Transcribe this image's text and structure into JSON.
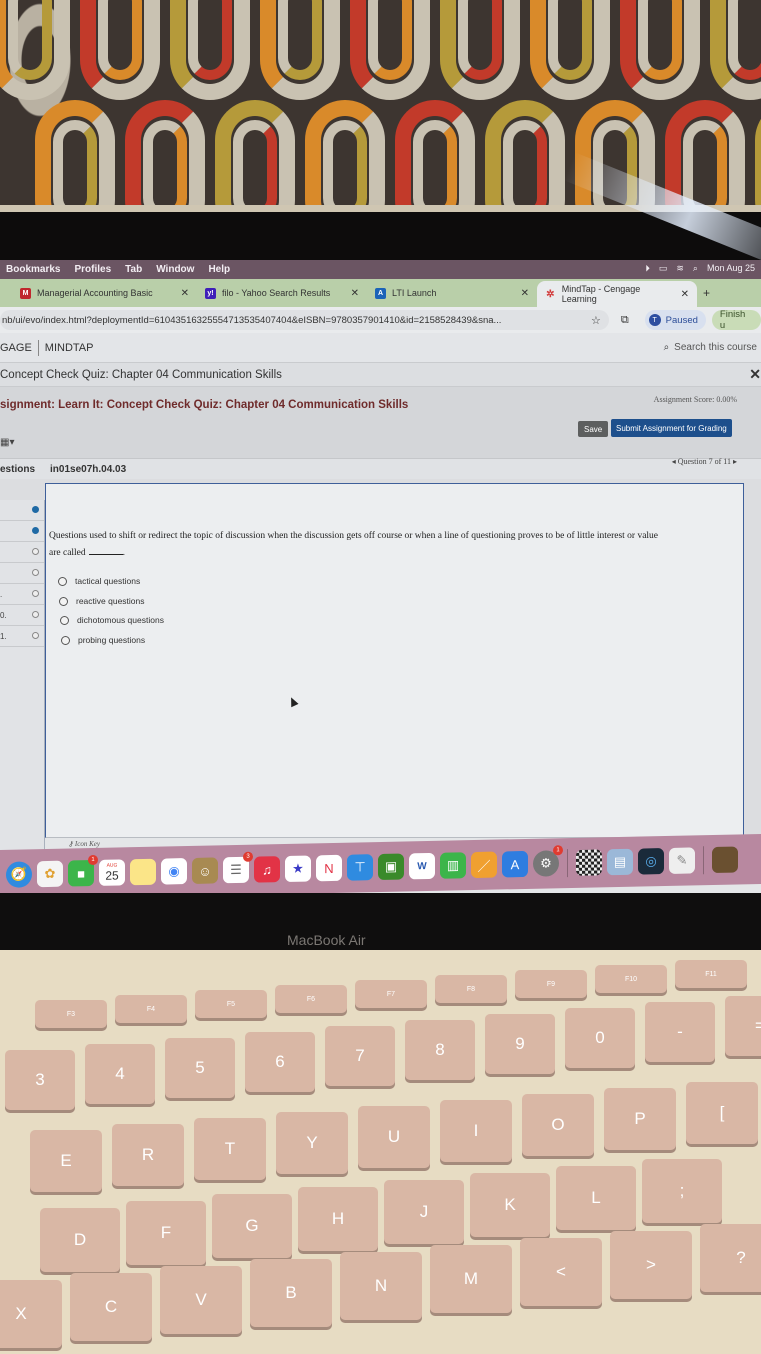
{
  "menubar": {
    "items": [
      "Bookmarks",
      "Profiles",
      "Tab",
      "Window",
      "Help"
    ],
    "clock": "Mon Aug 25"
  },
  "tabs": [
    {
      "label": "Managerial Accounting Basic",
      "favicon": "mcgraw-hill-icon",
      "active": false
    },
    {
      "label": "filo - Yahoo Search Results",
      "favicon": "yahoo-icon",
      "active": false
    },
    {
      "label": "LTI Launch",
      "favicon": "lti-icon",
      "active": false
    },
    {
      "label": "MindTap - Cengage Learning",
      "favicon": "mindtap-icon",
      "active": true
    }
  ],
  "address": {
    "url": "nb/ui/evo/index.html?deploymentId=61043516325554713535407404&eISBN=9780357901410&id=2158528439&sna...",
    "profile_initial": "T",
    "profile_status": "Paused",
    "finish_label": "Finish u"
  },
  "brand": {
    "left": "GAGE",
    "right": "MINDTAP",
    "search_placeholder": "Search this course"
  },
  "breadcrumb": "Concept Check Quiz: Chapter 04 Communication Skills",
  "assignment": {
    "title": "signment: Learn It: Concept Check Quiz: Chapter 04 Communication Skills",
    "score": "Assignment Score: 0.00%",
    "save_label": "Save",
    "submit_label": "Submit Assignment for Grading"
  },
  "question_header": {
    "sidebar_label": "estions",
    "question_id": "in01se07h.04.03",
    "nav": "◂ Question 7 of 11 ▸"
  },
  "sidebar_rows": [
    {
      "num": "",
      "state": "done"
    },
    {
      "num": "",
      "state": "done"
    },
    {
      "num": "",
      "state": "open"
    },
    {
      "num": "",
      "state": "open"
    },
    {
      "num": ".",
      "state": "open"
    },
    {
      "num": "0.",
      "state": "open"
    },
    {
      "num": "1.",
      "state": "open"
    }
  ],
  "question": {
    "prompt_line1": "Questions used to shift or redirect the topic of discussion when the discussion gets off course or when a line of questioning proves to be of little interest or value",
    "prompt_line2": "are called",
    "prompt_end": ".",
    "options": [
      "tactical questions",
      "reactive questions",
      "dichotomous questions",
      "probing questions"
    ]
  },
  "icon_key_label": "Icon Key",
  "dock": {
    "calendar_month": "AUG",
    "calendar_day": "25",
    "facetime_badge": "1",
    "reminders_badge": "3",
    "settings_badge": "1"
  },
  "laptop_label": "MacBook Air",
  "keyboard": {
    "fn_row": [
      "F3",
      "F4",
      "F5",
      "F6",
      "F7",
      "F8",
      "F9",
      "F10",
      "F11"
    ],
    "num_row": [
      "3",
      "4",
      "5",
      "6",
      "7",
      "8",
      "9",
      "0",
      "-",
      "="
    ],
    "top_row": [
      "E",
      "R",
      "T",
      "Y",
      "U",
      "I",
      "O",
      "P",
      "["
    ],
    "home_row": [
      "D",
      "F",
      "G",
      "H",
      "J",
      "K",
      "L",
      ";"
    ],
    "bottom_row": [
      "X",
      "C",
      "V",
      "B",
      "N",
      "M",
      "<",
      ">",
      "?"
    ]
  }
}
